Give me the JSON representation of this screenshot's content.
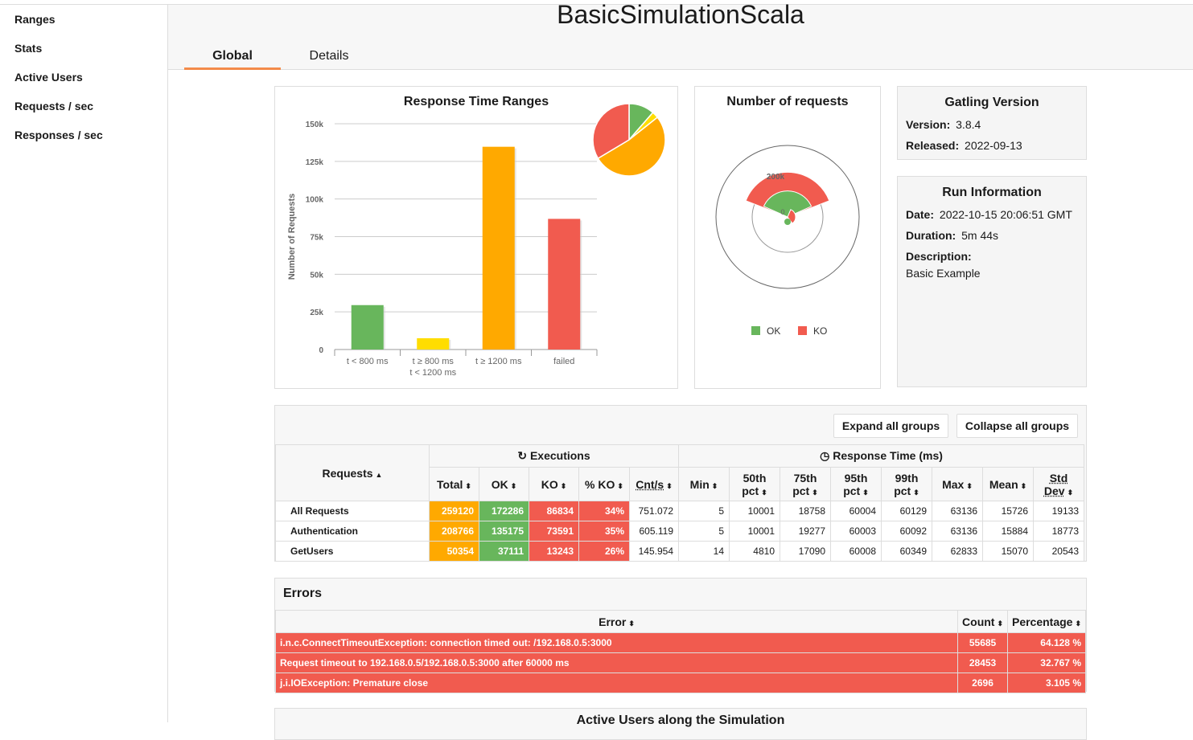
{
  "page_title": "BasicSimulationScala",
  "sidebar": {
    "items": [
      {
        "label": "Ranges"
      },
      {
        "label": "Stats"
      },
      {
        "label": "Active Users"
      },
      {
        "label": "Requests / sec"
      },
      {
        "label": "Responses / sec"
      }
    ]
  },
  "tabs": {
    "global": "Global",
    "details": "Details"
  },
  "colors": {
    "ok": "#68b65c",
    "ko": "#f15b4f",
    "range_mid": "#ffdd00",
    "range_high": "#ffa900",
    "accent": "#f38b4a"
  },
  "chart_data": [
    {
      "type": "bar",
      "title": "Response Time Ranges",
      "ylabel": "Number of Requests",
      "categories": [
        "t < 800 ms",
        "t ≥ 800 ms\nt < 1200 ms",
        "t ≥ 1200 ms",
        "failed"
      ],
      "values": [
        29500,
        7500,
        134700,
        86800
      ],
      "bar_colors": [
        "#68b65c",
        "#ffdd00",
        "#ffa900",
        "#f15b4f"
      ],
      "ylim": [
        0,
        150000
      ],
      "yticks": [
        "0",
        "25k",
        "50k",
        "75k",
        "100k",
        "125k",
        "150k"
      ],
      "pie": true
    },
    {
      "type": "pie",
      "title": "Number of requests",
      "series": [
        {
          "name": "OK",
          "value": 172286
        },
        {
          "name": "KO",
          "value": 86834
        }
      ],
      "axis_labels": [
        "200k",
        "0"
      ],
      "legend": [
        "OK",
        "KO"
      ]
    }
  ],
  "gatling": {
    "title": "Gatling Version",
    "version_label": "Version:",
    "version": "3.8.4",
    "released_label": "Released:",
    "released": "2022-09-13"
  },
  "run": {
    "title": "Run Information",
    "date_label": "Date:",
    "date": "2022-10-15 20:06:51 GMT",
    "duration_label": "Duration:",
    "duration": "5m 44s",
    "description_label": "Description:",
    "description": "Basic Example"
  },
  "stats": {
    "expand_label": "Expand all groups",
    "collapse_label": "Collapse all groups",
    "requests_header": "Requests",
    "executions_header": "Executions",
    "response_time_header": "Response Time (ms)",
    "columns": [
      "Total",
      "OK",
      "KO",
      "% KO",
      "Cnt/s",
      "Min",
      "50th pct",
      "75th pct",
      "95th pct",
      "99th pct",
      "Max",
      "Mean",
      "Std Dev"
    ],
    "rows": [
      {
        "name": "All Requests",
        "values": [
          "259120",
          "172286",
          "86834",
          "34%",
          "751.072",
          "5",
          "10001",
          "18758",
          "60004",
          "60129",
          "63136",
          "15726",
          "19133"
        ]
      },
      {
        "name": "Authentication",
        "values": [
          "208766",
          "135175",
          "73591",
          "35%",
          "605.119",
          "5",
          "10001",
          "19277",
          "60003",
          "60092",
          "63136",
          "15884",
          "18773"
        ]
      },
      {
        "name": "GetUsers",
        "values": [
          "50354",
          "37111",
          "13243",
          "26%",
          "145.954",
          "14",
          "4810",
          "17090",
          "60008",
          "60349",
          "62833",
          "15070",
          "20543"
        ]
      }
    ]
  },
  "errors": {
    "title": "Errors",
    "columns": [
      "Error",
      "Count",
      "Percentage"
    ],
    "rows": [
      {
        "error": "i.n.c.ConnectTimeoutException: connection timed out: /192.168.0.5:3000",
        "count": "55685",
        "percentage": "64.128 %"
      },
      {
        "error": "Request timeout to 192.168.0.5/192.168.0.5:3000 after 60000 ms",
        "count": "28453",
        "percentage": "32.767 %"
      },
      {
        "error": "j.i.IOException: Premature close",
        "count": "2696",
        "percentage": "3.105 %"
      }
    ]
  },
  "active_users_title": "Active Users along the Simulation"
}
